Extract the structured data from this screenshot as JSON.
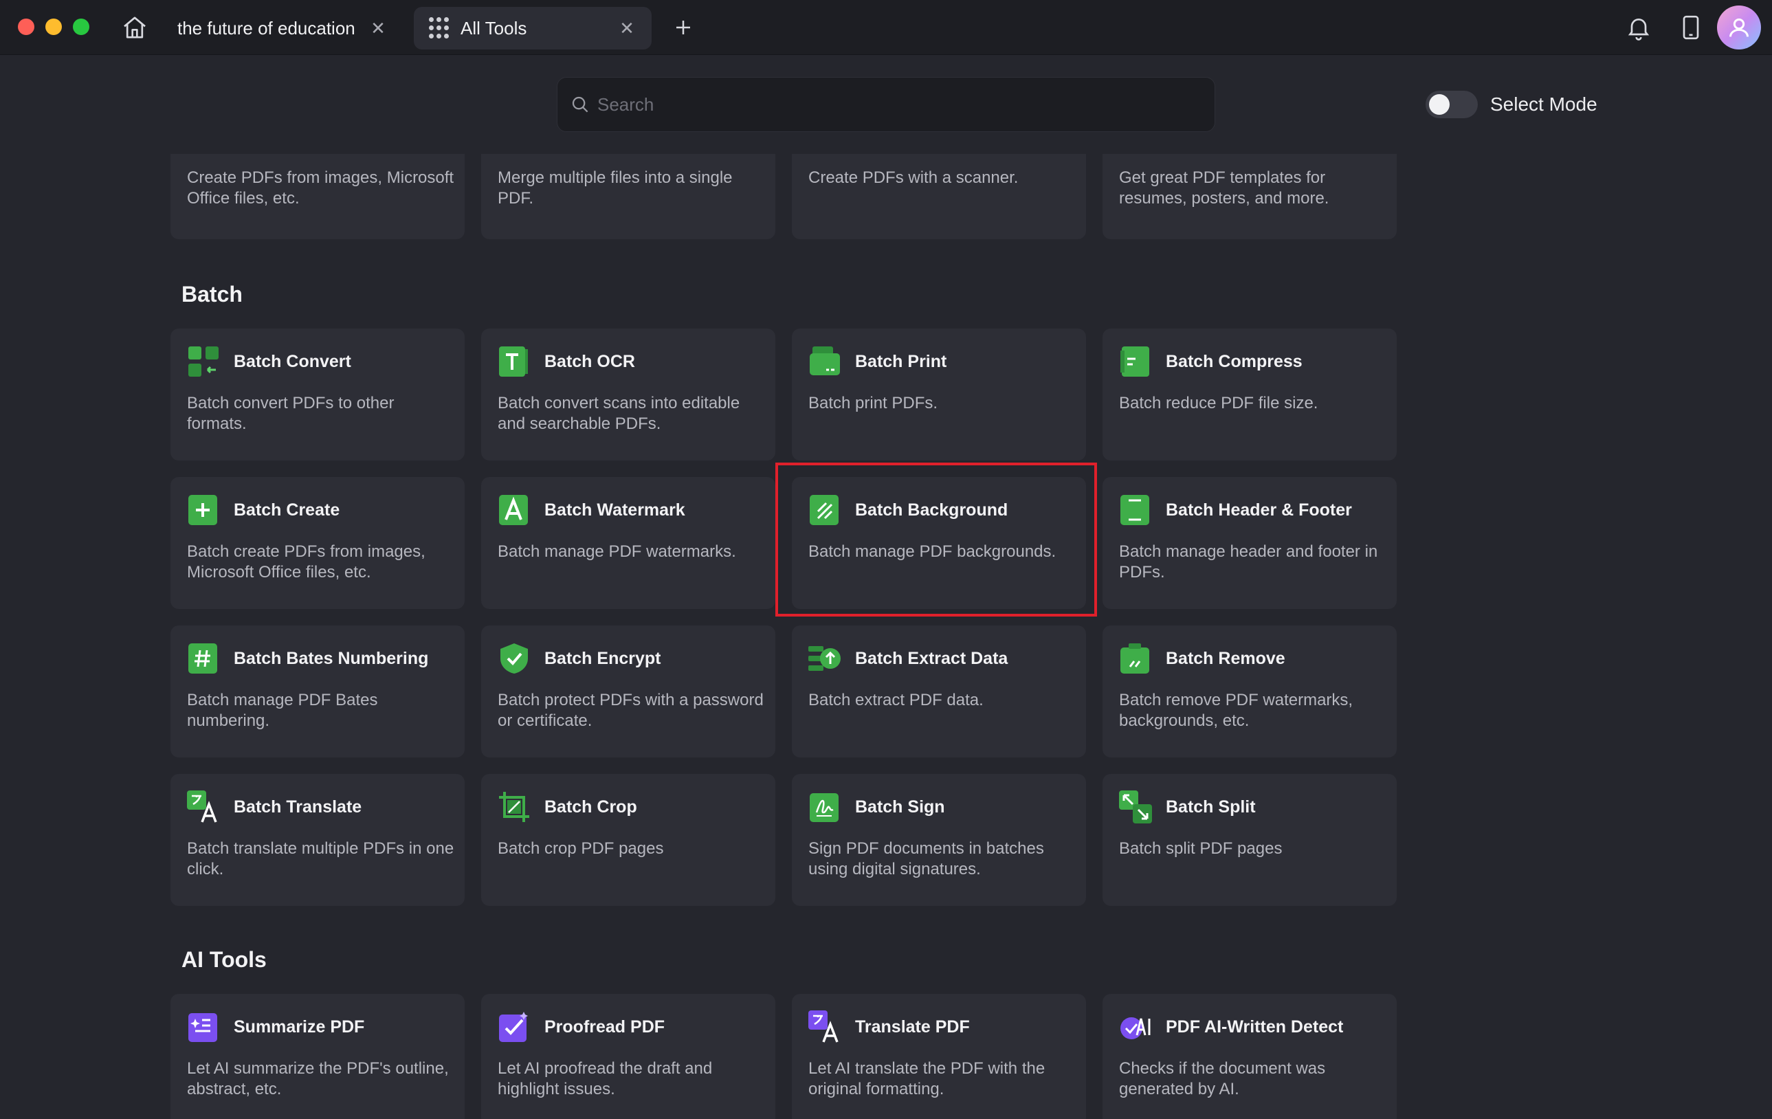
{
  "tabs": [
    {
      "label": "the future of education"
    },
    {
      "label": "All Tools"
    }
  ],
  "search": {
    "placeholder": "Search"
  },
  "select_mode": {
    "label": "Select Mode",
    "enabled": false
  },
  "colors": {
    "accent_green": "#3fae49",
    "accent_purple": "#7b4ff0",
    "highlight_red": "#e0202b"
  },
  "top_cards": [
    {
      "desc": "Create PDFs from images, Microsoft Office files, etc."
    },
    {
      "desc": "Merge multiple files into a single PDF."
    },
    {
      "desc": "Create PDFs with a scanner."
    },
    {
      "desc": "Get great PDF templates for resumes, posters, and more."
    }
  ],
  "batch": {
    "title": "Batch",
    "cards": [
      {
        "title": "Batch Convert",
        "desc": "Batch convert PDFs to other formats.",
        "icon": "convert-icon"
      },
      {
        "title": "Batch OCR",
        "desc": "Batch convert scans into editable and searchable PDFs.",
        "icon": "ocr-icon"
      },
      {
        "title": "Batch Print",
        "desc": "Batch print PDFs.",
        "icon": "print-icon"
      },
      {
        "title": "Batch Compress",
        "desc": "Batch reduce PDF file size.",
        "icon": "compress-icon"
      },
      {
        "title": "Batch Create",
        "desc": "Batch create PDFs from images, Microsoft Office files, etc.",
        "icon": "create-icon"
      },
      {
        "title": "Batch Watermark",
        "desc": "Batch manage PDF watermarks.",
        "icon": "watermark-icon"
      },
      {
        "title": "Batch Background",
        "desc": "Batch manage PDF backgrounds.",
        "icon": "background-icon"
      },
      {
        "title": "Batch Header & Footer",
        "desc": "Batch manage header and footer in PDFs.",
        "icon": "header-footer-icon"
      },
      {
        "title": "Batch Bates Numbering",
        "desc": "Batch manage PDF Bates numbering.",
        "icon": "bates-icon"
      },
      {
        "title": "Batch Encrypt",
        "desc": "Batch protect PDFs with a password or certificate.",
        "icon": "encrypt-icon"
      },
      {
        "title": "Batch Extract Data",
        "desc": "Batch extract PDF data.",
        "icon": "extract-icon"
      },
      {
        "title": "Batch Remove",
        "desc": "Batch remove PDF watermarks, backgrounds, etc.",
        "icon": "remove-icon"
      },
      {
        "title": "Batch Translate",
        "desc": "Batch translate multiple PDFs in one click.",
        "icon": "translate-icon"
      },
      {
        "title": "Batch Crop",
        "desc": "Batch crop PDF pages",
        "icon": "crop-icon"
      },
      {
        "title": "Batch Sign",
        "desc": "Sign PDF documents in batches using digital signatures.",
        "icon": "sign-icon"
      },
      {
        "title": "Batch Split",
        "desc": "Batch split PDF pages",
        "icon": "split-icon"
      }
    ]
  },
  "ai": {
    "title": "AI Tools",
    "cards": [
      {
        "title": "Summarize PDF",
        "desc": "Let AI summarize the PDF's outline, abstract, etc.",
        "icon": "summarize-icon"
      },
      {
        "title": "Proofread PDF",
        "desc": "Let AI proofread the draft and highlight issues.",
        "icon": "proofread-icon"
      },
      {
        "title": "Translate PDF",
        "desc": "Let AI translate the PDF with the original formatting.",
        "icon": "ai-translate-icon"
      },
      {
        "title": "PDF AI-Written Detect",
        "desc": "Checks if the document was generated by AI.",
        "icon": "ai-detect-icon"
      }
    ]
  }
}
